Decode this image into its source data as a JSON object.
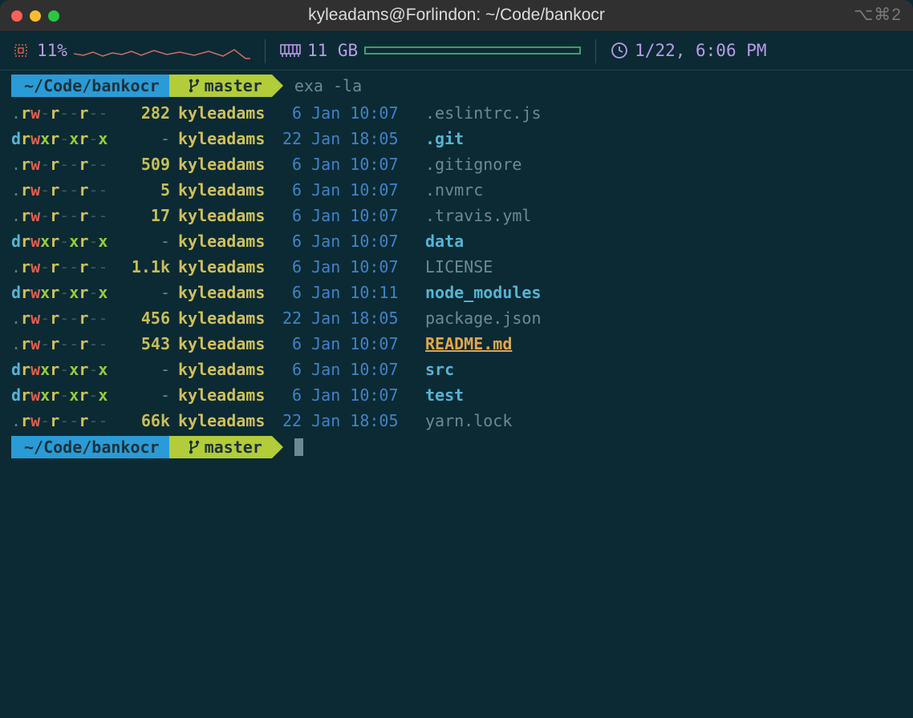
{
  "window": {
    "title": "kyleadams@Forlindon: ~/Code/bankocr",
    "shortcut": "⌥⌘2"
  },
  "status": {
    "cpu_pct": "11%",
    "memory": "11 GB",
    "datetime": "1/22, 6:06 PM"
  },
  "prompt": {
    "cwd": "~/Code/bankocr",
    "branch": "master",
    "command": "exa -la"
  },
  "listing": [
    {
      "perm": ".rw-r--r--",
      "size": "282",
      "owner": "kyleadams",
      "date": " 6 Jan 10:07",
      "name": ".eslintrc.js",
      "kind": "file"
    },
    {
      "perm": "drwxr-xr-x",
      "size": "-",
      "owner": "kyleadams",
      "date": "22 Jan 18:05",
      "name": ".git",
      "kind": "dir"
    },
    {
      "perm": ".rw-r--r--",
      "size": "509",
      "owner": "kyleadams",
      "date": " 6 Jan 10:07",
      "name": ".gitignore",
      "kind": "file"
    },
    {
      "perm": ".rw-r--r--",
      "size": "5",
      "owner": "kyleadams",
      "date": " 6 Jan 10:07",
      "name": ".nvmrc",
      "kind": "file"
    },
    {
      "perm": ".rw-r--r--",
      "size": "17",
      "owner": "kyleadams",
      "date": " 6 Jan 10:07",
      "name": ".travis.yml",
      "kind": "file"
    },
    {
      "perm": "drwxr-xr-x",
      "size": "-",
      "owner": "kyleadams",
      "date": " 6 Jan 10:07",
      "name": "data",
      "kind": "dir"
    },
    {
      "perm": ".rw-r--r--",
      "size": "1.1k",
      "owner": "kyleadams",
      "date": " 6 Jan 10:07",
      "name": "LICENSE",
      "kind": "file"
    },
    {
      "perm": "drwxr-xr-x",
      "size": "-",
      "owner": "kyleadams",
      "date": " 6 Jan 10:11",
      "name": "node_modules",
      "kind": "dir"
    },
    {
      "perm": ".rw-r--r--",
      "size": "456",
      "owner": "kyleadams",
      "date": "22 Jan 18:05",
      "name": "package.json",
      "kind": "file"
    },
    {
      "perm": ".rw-r--r--",
      "size": "543",
      "owner": "kyleadams",
      "date": " 6 Jan 10:07",
      "name": "README.md",
      "kind": "readme"
    },
    {
      "perm": "drwxr-xr-x",
      "size": "-",
      "owner": "kyleadams",
      "date": " 6 Jan 10:07",
      "name": "src",
      "kind": "dir"
    },
    {
      "perm": "drwxr-xr-x",
      "size": "-",
      "owner": "kyleadams",
      "date": " 6 Jan 10:07",
      "name": "test",
      "kind": "dir"
    },
    {
      "perm": ".rw-r--r--",
      "size": "66k",
      "owner": "kyleadams",
      "date": "22 Jan 18:05",
      "name": "yarn.lock",
      "kind": "file"
    }
  ]
}
